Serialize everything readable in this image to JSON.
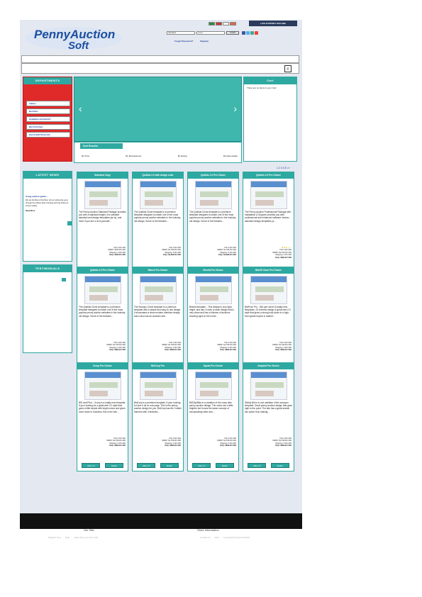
{
  "header": {
    "support_label": "LIVE SUPPORT OFFLINE",
    "logo_top": "PennyAuction",
    "logo_bottom": "Soft",
    "username_value": "username",
    "password_value": "••••••••",
    "login_label": "LOGIN",
    "forgot_label": "Forgot Password?",
    "register_label": "Register"
  },
  "departments": {
    "title": "DEPARTMENTS",
    "items": [
      "Addons",
      "Mod Pack",
      "Installation and Add-On?",
      "Mini Thrill Pack",
      "Dont bonkfil Phone Add"
    ]
  },
  "sort": {
    "title": "Sort Results:",
    "links": [
      "By Price",
      "By Manufacturer",
      "By Rating",
      "By Date Added"
    ]
  },
  "cart": {
    "title": "Cart",
    "text": "There are no items in your Cart"
  },
  "pager": "1 2 3 4 5 >>",
  "news": {
    "title": "LATEST NEWS",
    "headline": "Using auction guide...",
    "body": "We are the Best of the Best. All our coding has gone through the tedious task of testing and bug finding to ensure quality.",
    "more": "Read More"
  },
  "testimonials": {
    "title": "TESTIMONIALS"
  },
  "products": [
    {
      "title": "Standard Copy",
      "desc": "The Penny Auction Standard Package provides you with a standard engine of a software standard and design templates (as is), and more if you are a do-it-yourself...",
      "total": "TAX 0.00 USD",
      "msrp": "MSRP: $799.00 USD",
      "ship": "Shipping: 0.00 USD",
      "only": "Only: $499.00 USD",
      "stars": "",
      "add": "ADD_TO",
      "detail": "Details"
    },
    {
      "title": "Quibids 2.0 with design suite",
      "desc": "The Quibids Clone template is a premium template designed to match one of the most popular penny auction websites in the industry. old design. Some of the features...",
      "total": "TAX 0.00 USD",
      "msrp": "MSRP: $1,799.00 USD",
      "ship": "Shipping: 0.00 USD",
      "only": "Only: $2,999.00 USD",
      "stars": "",
      "add": "ADD_TO",
      "detail": "Details"
    },
    {
      "title": "Quibids 2.0 Pro Choice",
      "desc": "The Quibids Clone template is a premium template designed to match one of the most popular penny auction websites in the industry. old design. Some of the features...",
      "total": "TAX 0.00 USD",
      "msrp": "MSRP: $1,799.00 USD",
      "ship": "Shipping: 0.00 USD",
      "only": "Only: $2,999.00 USD",
      "stars": "",
      "add": "ADD_TO",
      "detail": "Details"
    },
    {
      "title": "Quibids 2.0 Pro Choice",
      "desc": "The Penny Auction Professional Package with Installation & Support provides you with professional and enhanced software version, standard design templates (a...",
      "total": "TAX 0.00 USD",
      "msrp": "MSRP: $2,799.00 USD",
      "ship": "Shipping: 0.00 USD",
      "only": "Only: $999.00 USD",
      "stars": "★★★☆☆",
      "add": "ADD_TO",
      "detail": "Details"
    },
    {
      "title": "Quibids 2.0 Pro Choice",
      "desc": "The Quibids Clone template is a premium template designed to match one of the most popular penny auction websites in the industry. old design. Some of the features...",
      "total": "TAX 0.00 USD",
      "msrp": "MSRP: $1,799.00 USD",
      "ship": "Shipping: 0.00 USD",
      "only": "Only: $999.00 USD",
      "stars": "",
      "add": "ADD_TO",
      "detail": "Details"
    },
    {
      "title": "Wavee Pro Choice",
      "desc": "The Swoopo Clone template is a premium template with a simple and easy to use design. It showcases a clean modern interface design and it also has an auctions site...",
      "total": "TAX 0.00 USD",
      "msrp": "MSRP: $1,799.00 USD",
      "ship": "Shipping: 0.00 USD",
      "only": "Only: $999.00 USD",
      "stars": "",
      "add": "ADD_TO",
      "detail": "Details"
    },
    {
      "title": "Beezid Pro Choice",
      "desc": "Beezid template... This design is very light, bright, and airy. It uses a clean design that is very clean and has a fullness of auctions showing right on the home...",
      "total": "TAX 0.00 USD",
      "msrp": "MSRP: $1,799.00 USD",
      "ship": "Shipping: 0.00 USD",
      "only": "Only: $999.00 USD",
      "stars": "",
      "add": "ADD_TO",
      "detail": "Details"
    },
    {
      "title": "Bidrift Clone Pro Choice",
      "desc": "BidFrom Pro... Bid cart clone! A totally new templates. Of a terrific design & great web 2.0 style that gives a strong look-down in a high-level grade buyers & market...",
      "total": "TAX 0.00 USD",
      "msrp": "MSRP: $1,799.00 USD",
      "ship": "Shipping: 0.00 USD",
      "only": "Only: $999.00 USD",
      "stars": "",
      "add": "ADD_TO",
      "detail": "Details"
    },
    {
      "title": "Xcorp Pro Choice",
      "desc": "BID and Pilot... Xcorp is a totally new template. If your looking for a great web 2.0 style that goes a little simple with bright colors and gives more down in business, this is the site...",
      "total": "TAX 0.00 USD",
      "msrp": "MSRP: $1,799.00 USD",
      "ship": "Shipping: 0.00 USD",
      "only": "Only: $999.00 USD",
      "stars": "",
      "add": "ADD_TO",
      "detail": "Details"
    },
    {
      "title": "BidCorp Pro",
      "desc": "BidCorp is a premium template. If your looking to have it all on one page. This is the penny auction design for you. BidCorp has the 3 slider banners with 4 featured...",
      "total": "TAX 0.00 USD",
      "msrp": "MSRP: $1,799.00 USD",
      "ship": "Shipping: 0.00 USD",
      "only": "Only: $999.00 USD",
      "stars": "",
      "add": "ADD_TO",
      "detail": "Details"
    },
    {
      "title": "Spade Pro Choice",
      "desc": "BIDZip/Bids is a variation of the crazy bids penny auction design. The colors are a little brighter but it uses the same concept of incorporating video into...",
      "total": "TAX 0.00 USD",
      "msrp": "MSRP: $1,799.00 USD",
      "ship": "Shipping: 0.00 USD",
      "only": "Only: $999.00 USD",
      "stars": "",
      "add": "ADD_TO",
      "detail": "Details"
    },
    {
      "title": "Snapbid Pro Choice",
      "desc": "Slickly Bid is a cool variation of the swooper template. Great penny auction design that goes right to the point. The site has a great search bar option thus making...",
      "total": "TAX 0.00 USD",
      "msrp": "MSRP: $1,799.00 USD",
      "ship": "Shipping: 0.00 USD",
      "only": "Only: $999.00 USD",
      "stars": "",
      "add": "ADD_TO",
      "detail": "Details"
    }
  ],
  "footer": {
    "left_title": "Our Site",
    "right_title": "Store Information",
    "left_links": [
      "Register Now",
      "Help",
      "About Penny Auction Soft"
    ],
    "right_links": [
      "Contact Us",
      "FAQ",
      "Copyright PennyAuctionSoft"
    ]
  },
  "colors": {
    "accent": "#2ea9a1",
    "department_bg": "#e02a2a",
    "footer_bar": "#111111"
  }
}
